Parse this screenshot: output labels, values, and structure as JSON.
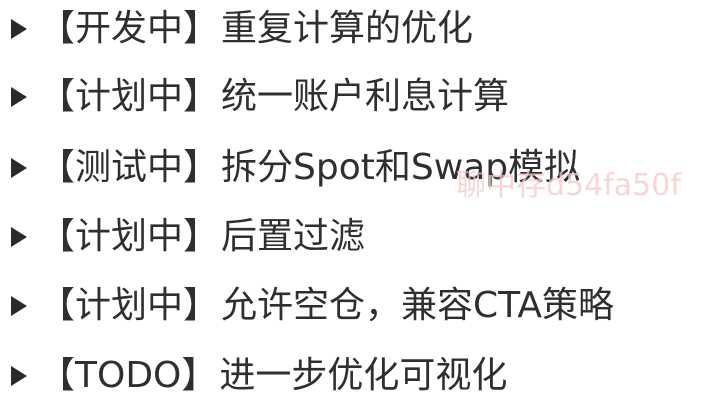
{
  "watermark": "聊中存d54fa50f",
  "items": [
    {
      "status": "【开发中】",
      "title": "重复计算的优化"
    },
    {
      "status": "【计划中】",
      "title": "统一账户利息计算"
    },
    {
      "status": "【测试中】",
      "title": "拆分Spot和Swap模拟"
    },
    {
      "status": "【计划中】",
      "title": "后置过滤"
    },
    {
      "status": "【计划中】",
      "title": "允许空仓，兼容CTA策略"
    },
    {
      "status": "【TODO】",
      "title": "进一步优化可视化"
    }
  ]
}
